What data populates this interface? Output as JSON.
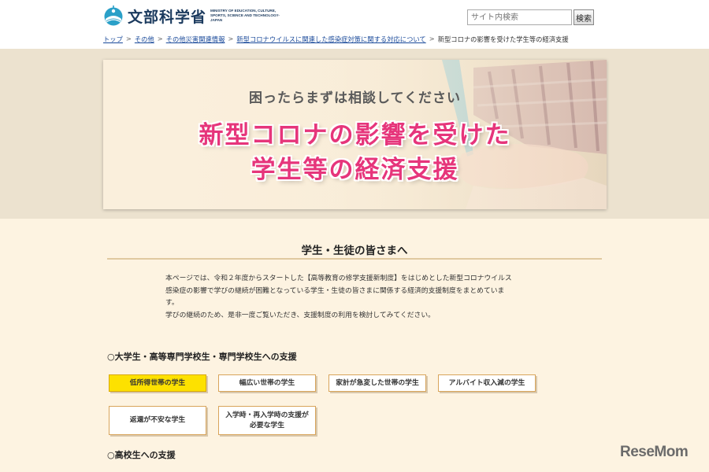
{
  "header": {
    "logo_jp": "文部科学省",
    "logo_en": "MINISTRY OF EDUCATION, CULTURE, SPORTS, SCIENCE AND TECHNOLOGY-JAPAN",
    "search_placeholder": "サイト内検索",
    "search_button": "検索"
  },
  "breadcrumb": {
    "items": [
      "トップ",
      "その他",
      "その他災害関連情報",
      "新型コロナウイルスに関連した感染症対策に関する対応について"
    ],
    "current": "新型コロナの影響を受けた学生等の経済支援",
    "separator": ">"
  },
  "hero": {
    "subtitle": "困ったらまずは相談してください",
    "title_line1": "新型コロナの影響を受けた",
    "title_line2": "学生等の経済支援"
  },
  "main": {
    "section_title": "学生・生徒の皆さまへ",
    "intro_lines": [
      "本ページでは、令和２年度からスタートした【高等教育の修学支援新制度】をはじめとした新型コロナウイルス",
      "感染症の影響で学びの継続が困難となっている学生・生徒の皆さまに関係する経済的支援制度をまとめていま",
      "す。",
      "学びの継続のため、是非一度ご覧いただき、支援制度の利用を検討してみてください。"
    ],
    "group1_title": "○大学生・高等専門学校生・専門学校生への支援",
    "group1_buttons": [
      "低所得世帯の学生",
      "幅広い世帯の学生",
      "家計が急変した世帯の学生",
      "アルバイト収入減の学生",
      "返還が不安な学生",
      "入学時・再入学時の支援が",
      "必要な学生"
    ],
    "group2_title": "○高校生への支援"
  },
  "watermark": "ReseMom",
  "colors": {
    "accent_pink": "#e6357b",
    "active_button": "#fde100",
    "button_border": "#d8a45a",
    "page_bg": "#fdf3e1",
    "link": "#1a4a9a",
    "logo_blue": "#2aa0c8"
  }
}
